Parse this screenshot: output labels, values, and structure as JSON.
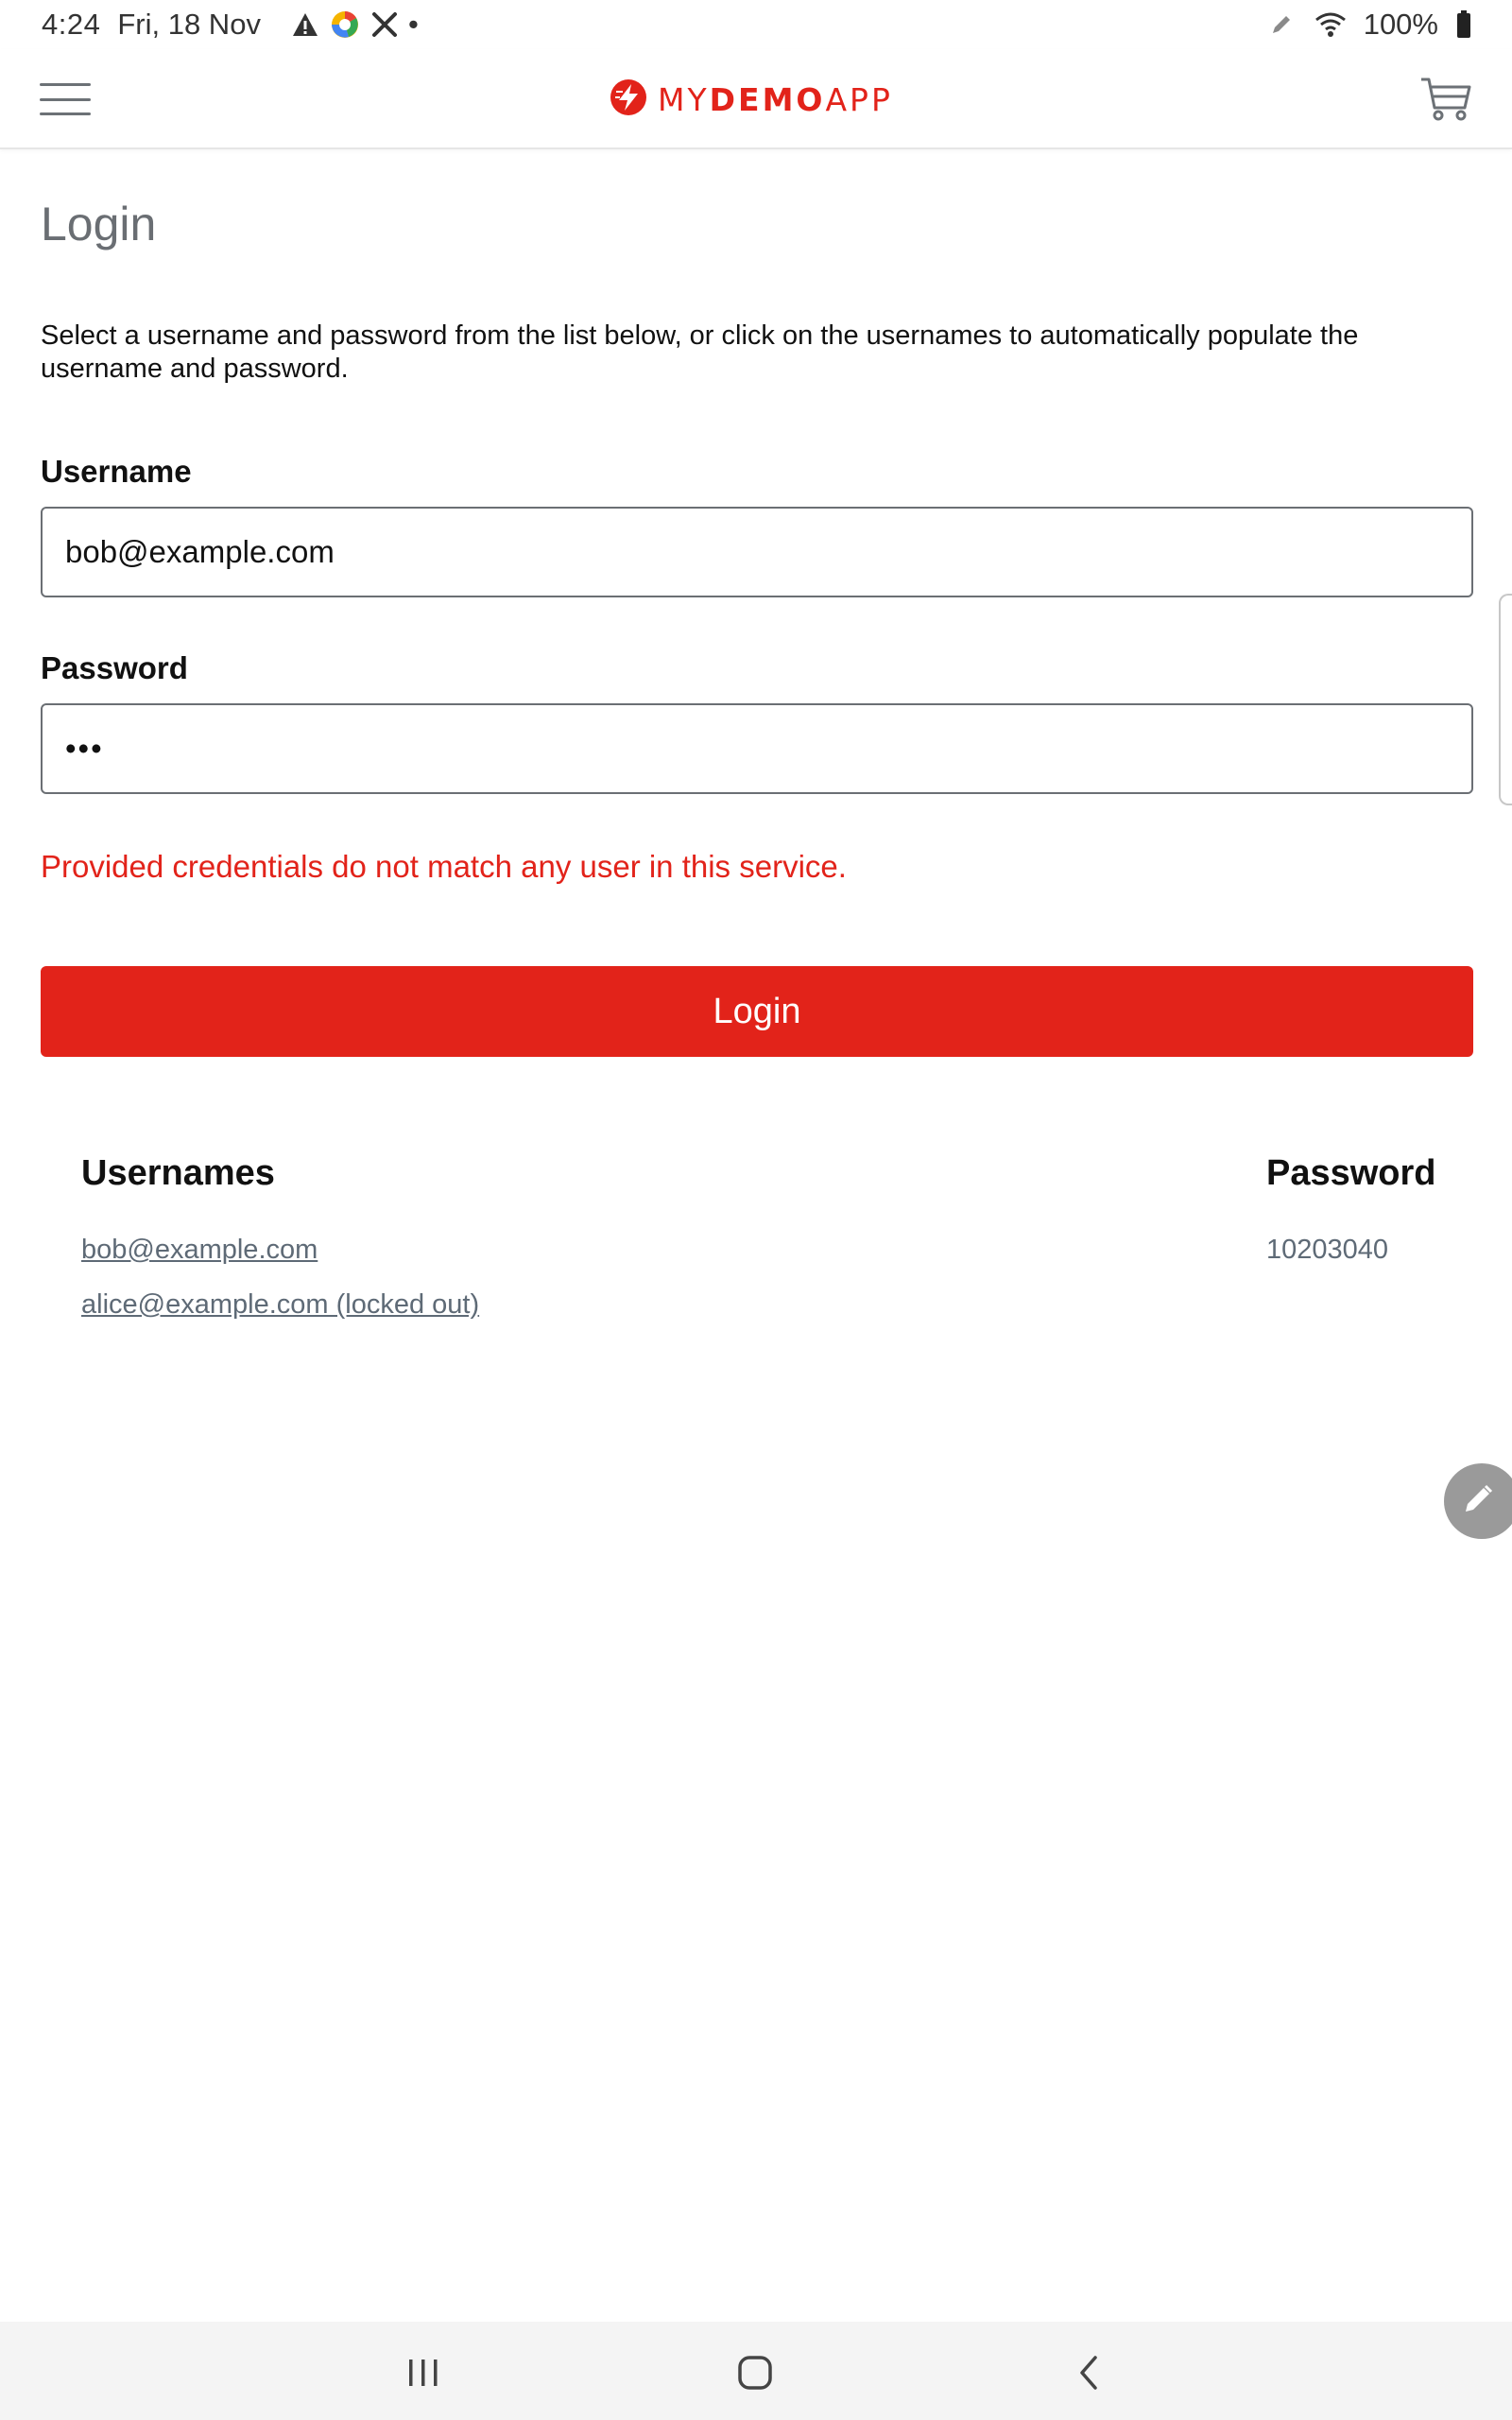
{
  "status_bar": {
    "time": "4:24",
    "date": "Fri, 18 Nov",
    "dot": "•",
    "battery": "100%",
    "icons": [
      "warning-icon",
      "chrome-like-app-icon",
      "tools-icon",
      "pen-icon",
      "wifi-icon",
      "battery-icon"
    ]
  },
  "header": {
    "logo": {
      "prefix": "MY",
      "bold": "DEMO",
      "suffix": "APP"
    },
    "icons": [
      "hamburger-menu-icon",
      "lightning-logo-icon",
      "cart-icon"
    ]
  },
  "login": {
    "title": "Login",
    "instructions": "Select a username and password from the list below, or click on the usernames to automatically populate the username and password.",
    "username_label": "Username",
    "username_value": "bob@example.com",
    "password_label": "Password",
    "password_value": "•••",
    "error": "Provided credentials do not match any user in this service.",
    "button_label": "Login"
  },
  "credentials": {
    "usernames_header": "Usernames",
    "password_header": "Password",
    "users": [
      "bob@example.com",
      "alice@example.com (locked out)"
    ],
    "password": "10203040"
  },
  "colors": {
    "brand_red": "#e2231a",
    "title_gray": "#6a6e73",
    "link_gray": "#5e6a76"
  }
}
